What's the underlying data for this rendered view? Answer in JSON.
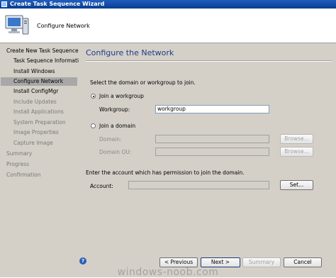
{
  "window": {
    "title": "Create Task Sequence Wizard"
  },
  "header": {
    "subtitle": "Configure Network"
  },
  "sidebar": {
    "items": [
      {
        "label": "Create New Task Sequence",
        "state": "normal"
      },
      {
        "label": "Task Sequence Information",
        "state": "normal"
      },
      {
        "label": "Install Windows",
        "state": "normal"
      },
      {
        "label": "Configure Network",
        "state": "selected"
      },
      {
        "label": "Install ConfigMgr",
        "state": "normal"
      },
      {
        "label": "Include Updates",
        "state": "disabled"
      },
      {
        "label": "Install Applications",
        "state": "disabled"
      },
      {
        "label": "System Preparation",
        "state": "disabled"
      },
      {
        "label": "Image Properties",
        "state": "disabled"
      },
      {
        "label": "Capture Image",
        "state": "disabled"
      },
      {
        "label": "Summary",
        "state": "disabled"
      },
      {
        "label": "Progress",
        "state": "disabled"
      },
      {
        "label": "Confirmation",
        "state": "disabled"
      }
    ]
  },
  "main": {
    "title": "Configure the Network",
    "instruction": "Select the domain or workgroup to join.",
    "join_workgroup_label": "Join a workgroup",
    "workgroup_label": "Workgroup:",
    "workgroup_value": "workgroup",
    "join_domain_label": "Join a domain",
    "domain_label": "Domain:",
    "domain_ou_label": "Domain OU:",
    "browse_label": "Browse...",
    "account_instruction": "Enter the account which has permission to join the domain.",
    "account_label": "Account:",
    "set_label": "Set..."
  },
  "footer": {
    "previous_label": "< Previous",
    "next_label": "Next >",
    "summary_label": "Summary",
    "cancel_label": "Cancel"
  },
  "watermark": "windows-noob.com",
  "colors": {
    "title_accent": "#1f3c89",
    "titlebar": "#0a3d91",
    "selection": "#a8a8a8"
  }
}
